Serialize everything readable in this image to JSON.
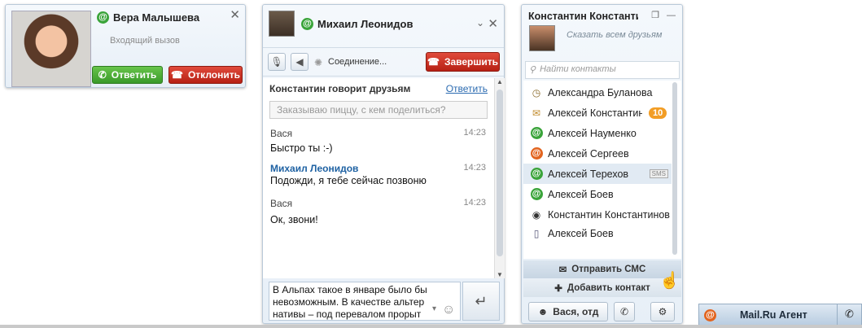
{
  "incoming_call": {
    "caller": "Вера Малышева",
    "status": "Входящий вызов",
    "answer_label": "Ответить",
    "decline_label": "Отклонить"
  },
  "chat": {
    "title": "Михаил Леонидов",
    "call_status": "Соединение...",
    "end_call_label": "Завершить",
    "broadcast": {
      "title": "Константин говорит друзьям",
      "reply_label": "Ответить",
      "input_placeholder": "Заказываю пиццу, с кем поделиться?"
    },
    "messages": [
      {
        "author": "Вася",
        "time": "14:23",
        "text": "Быстро ты :-)"
      },
      {
        "author": "Михаил Леонидов",
        "time": "14:23",
        "text": "Подожди, я тебе сейчас позвоню"
      },
      {
        "author": "Вася",
        "time": "14:23",
        "text": "Ок, звони!"
      }
    ],
    "compose_text": "В Альпах такое в январе было бы невозможным.  В качестве альтер нативы – под перевалом прорыт"
  },
  "contacts": {
    "owner": "Константин Константинов",
    "status_placeholder": "Сказать всем друзьям",
    "search_placeholder": "Найти контакты",
    "items": [
      {
        "name": "Александра Буланова",
        "icon": "clock-icon"
      },
      {
        "name": "Алексей Константинов",
        "icon": "envelope-icon",
        "badge": "10"
      },
      {
        "name": "Алексей Науменко",
        "icon": "at-green-icon"
      },
      {
        "name": "Алексей Сергеев",
        "icon": "at-orange-icon"
      },
      {
        "name": "Алексей Терехов",
        "icon": "at-green-icon",
        "tag": "SMS"
      },
      {
        "name": "Алексей Боев",
        "icon": "at-green-icon"
      },
      {
        "name": "Константин Константинов",
        "icon": "eye-icon"
      },
      {
        "name": "Алексей Боев",
        "icon": "phone-icon"
      }
    ],
    "send_sms_label": "Отправить СМС",
    "add_contact_label": "Добавить контакт",
    "footer_user": "Вася, отд"
  },
  "taskbar": {
    "label": "Mail.Ru Агент"
  }
}
